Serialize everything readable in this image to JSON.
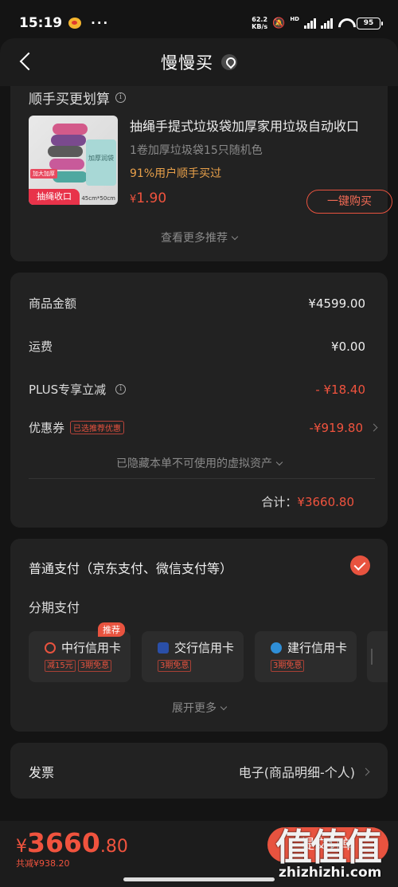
{
  "status_bar": {
    "time": "15:19",
    "dots": "···",
    "net_speed": "62.2",
    "net_unit": "KB/s",
    "battery": "95"
  },
  "nav": {
    "title": "慢慢买"
  },
  "recommend": {
    "section_title": "顺手买更划算",
    "product": {
      "title": "抽绳手提式垃圾袋加厚家用垃圾自动收口",
      "spec": "1卷加厚垃圾袋15只随机色",
      "stat": "91%用户顺手买过",
      "price_symbol": "¥",
      "price": "1.90",
      "img_badge": "抽绳收口",
      "img_tag": "加大加厚",
      "img_bag_text": "加厚润袋",
      "img_size": "45cm*50cm"
    },
    "buy_button": "一键购买",
    "more": "查看更多推荐"
  },
  "summary": {
    "rows": [
      {
        "label": "商品金额",
        "value": "¥4599.00"
      },
      {
        "label": "运费",
        "value": "¥0.00"
      },
      {
        "label": "PLUS专享立减",
        "value": "- ¥18.40"
      },
      {
        "label": "优惠券",
        "tag": "已选推荐优惠",
        "value": "-¥919.80"
      }
    ],
    "hidden_assets": "已隐藏本单不可使用的虚拟资产",
    "total_label": "合计：",
    "total_value": "¥3660.80"
  },
  "payment": {
    "normal": "普通支付（京东支付、微信支付等）",
    "installment_label": "分期支付",
    "recommend_tag": "推荐",
    "banks": [
      {
        "name": "中行信用卡",
        "tags": [
          "减15元",
          "3期免息"
        ],
        "color": "#e8533f"
      },
      {
        "name": "交行信用卡",
        "tags": [
          "3期免息"
        ],
        "color": "#2a4fa8"
      },
      {
        "name": "建行信用卡",
        "tags": [
          "3期免息"
        ],
        "color": "#2f8fd8"
      }
    ],
    "expand": "展开更多"
  },
  "invoice": {
    "label": "发票",
    "value": "电子(商品明细-个人)"
  },
  "bottom": {
    "price_symbol": "¥",
    "price_int": "3660",
    "price_dec": ".80",
    "saved": "共减¥938.20",
    "submit": "提交订单"
  },
  "watermark": {
    "chars": "值值值",
    "url": "zhizhizhi.com"
  },
  "colors": {
    "accent": "#e8533f",
    "bg": "#141414",
    "card": "#222222"
  }
}
